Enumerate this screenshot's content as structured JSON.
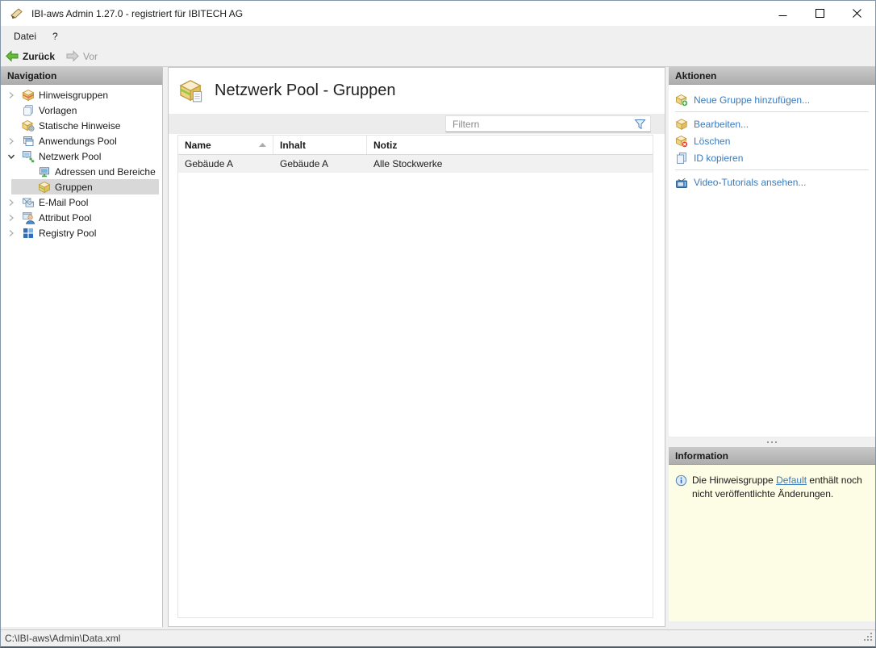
{
  "colors": {
    "link": "#3a7bbd",
    "info_background": "#fdfce4",
    "selection": "#d8d8d8",
    "back_arrow_green": "#66bb3f",
    "panel_header_top": "#c9c9c9",
    "panel_header_bottom": "#adadad"
  },
  "titlebar": {
    "title": "IBI-aws Admin 1.27.0 - registriert für IBITECH AG"
  },
  "menubar": {
    "items": [
      {
        "label": "Datei"
      },
      {
        "label": "?"
      }
    ]
  },
  "toolbar": {
    "back_label": "Zurück",
    "forward_label": "Vor"
  },
  "navigation": {
    "header": "Navigation",
    "items": [
      {
        "label": "Hinweisgruppen",
        "icon": "notice-groups-icon",
        "state": "collapsed"
      },
      {
        "label": "Vorlagen",
        "icon": "templates-icon",
        "state": "leaf"
      },
      {
        "label": "Statische Hinweise",
        "icon": "static-notices-icon",
        "state": "leaf"
      },
      {
        "label": "Anwendungs Pool",
        "icon": "application-pool-icon",
        "state": "collapsed"
      },
      {
        "label": "Netzwerk Pool",
        "icon": "network-pool-icon",
        "state": "expanded"
      },
      {
        "label": "Adressen und Bereiche",
        "icon": "addresses-icon",
        "state": "leaf",
        "level": 1
      },
      {
        "label": "Gruppen",
        "icon": "groups-icon",
        "state": "leaf",
        "level": 1,
        "selected": true
      },
      {
        "label": "E-Mail Pool",
        "icon": "email-pool-icon",
        "state": "collapsed"
      },
      {
        "label": "Attribut Pool",
        "icon": "attribute-pool-icon",
        "state": "collapsed"
      },
      {
        "label": "Registry Pool",
        "icon": "registry-pool-icon",
        "state": "collapsed"
      }
    ]
  },
  "main": {
    "title": "Netzwerk Pool - Gruppen",
    "filter_placeholder": "Filtern",
    "table": {
      "columns": [
        {
          "label": "Name",
          "sorted": "ascending"
        },
        {
          "label": "Inhalt"
        },
        {
          "label": "Notiz"
        }
      ],
      "rows": [
        {
          "name": "Gebäude A",
          "inhalt": "Gebäude A",
          "notiz": "Alle Stockwerke"
        }
      ]
    }
  },
  "actions": {
    "header": "Aktionen",
    "items": [
      {
        "label": "Neue Gruppe hinzufügen...",
        "icon": "add-group-icon"
      },
      {
        "label": "Bearbeiten...",
        "icon": "edit-group-icon"
      },
      {
        "label": "Löschen",
        "icon": "delete-group-icon"
      },
      {
        "label": "ID kopieren",
        "icon": "copy-id-icon"
      },
      {
        "label": "Video-Tutorials ansehen...",
        "icon": "video-tutorials-icon"
      }
    ]
  },
  "information": {
    "header": "Information",
    "message_before": "Die Hinweisgruppe ",
    "message_link": "Default",
    "message_after": " enthält noch nicht veröffentlichte Änderungen."
  },
  "statusbar": {
    "path": "C:\\IBI-aws\\Admin\\Data.xml"
  }
}
